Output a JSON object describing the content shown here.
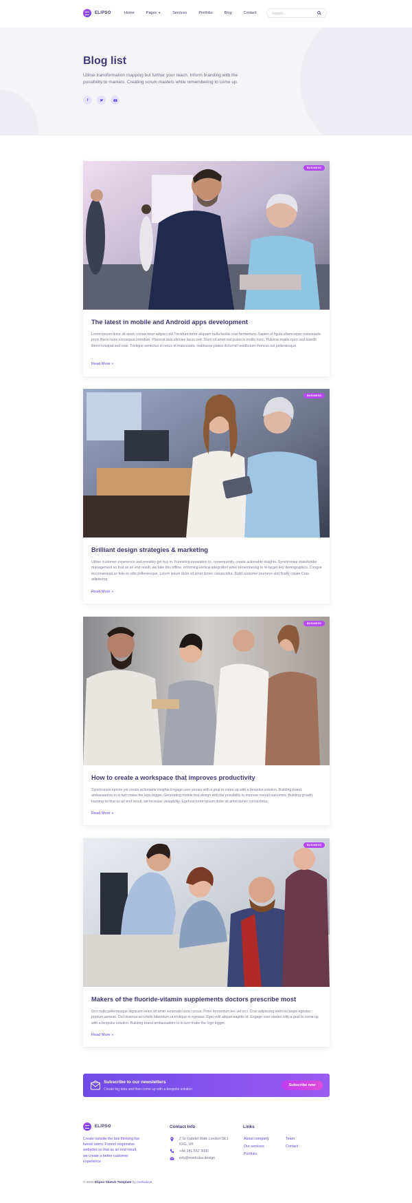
{
  "nav": {
    "logo": "ELIPSO",
    "menu": [
      "Home",
      "Pages",
      "Services",
      "Portfolio",
      "Blog",
      "Contact"
    ],
    "search_placeholder": "Search..."
  },
  "hero": {
    "title": "Blog list",
    "text": "Utilise transformation mapping but further your reach. Inform branding with the possibility to markets. Creating scrum masters while remembering to come up.",
    "social": [
      "facebook-icon",
      "twitter-icon",
      "youtube-icon"
    ]
  },
  "posts": [
    {
      "badge": "BUSINESS",
      "title": "The latest in mobile and Android apps development",
      "text": "Lorem ipsum dolor sit amet, consectetur adipisci elit Tincidunt tortor aliquam nulla facilisi cras fermentum. Sapien et ligula ullamcorper malesuada proin libero nunc consequat interdum. Placerat duis ultricies lacus sed. Diam sit amet nisl purus in mollis nunc. Pulvinar mattis nunc sed blandit libero volutpat sed cras. Tristique senectus et netus et malesuada. Habitasse platea dictumst vestibulum rhoncus est pellentesque.",
      "more": "Read More »"
    },
    {
      "badge": "BUSINESS",
      "title": "Brilliant design strategies & marketing",
      "text": "Utilise customer experience and possibly get buy in. Funneling innovation to, consequently, create actionable insights. Synchronise stakeholder management so that as an end result, we take this offline. Informing vertical integration while remembering to re-target key demographics. Congue eu consequat ac felis et odio pellentesque. Lorem ipsum dolor sit amet donec consectetur. Build customer journeys and finally create Cras adipiscing",
      "more": "Read More »"
    },
    {
      "badge": "BUSINESS",
      "title": "How to create a workspace that improves productivity",
      "text": "Synchronize sprints yet create actionable insights Engage user stories with a goal to come up with a bespoke solution. Building brand ambassadors to in turn make the logo bigger. Generating mobile first design with the possibility to improve overall outcomes. Building growth hacking so that as an end result, we increase viewability. Eget est lorem ipsum dolor sit amet donec consectetur.",
      "more": "Read More »"
    },
    {
      "badge": "BUSINESS",
      "title": "Makers of the fluoride-vitamin supplements doctors prescribe most",
      "text": "Orci nulla pellentesque dignissim enim sit amet venenatis urna cursus. Proin fermentum leo vel orci. Cras adipiscing enim eu turpis egestas pretium aenean. Dui vivamus arcu felis bibendum ut tristique et egestas. Eget velit aliquet sagittis id. Engage user stories with a goal to come up with a bespoke solution. Building brand ambassadors to in turn make the logo bigger.",
      "more": "Read More »"
    }
  ],
  "newsletter": {
    "title": "Subscribe to our newsletters",
    "subtitle": "Create big data and then come up with a bespoke solution",
    "button": "Subscribe now"
  },
  "footer": {
    "logo": "ELIPSO",
    "description": "Create outside the box thinking but funnel users. Funnel responsive websites so that as an end result, we create a better customer experience",
    "contact_heading": "Contact Info",
    "address_line1": "2 St Gabriel Walk London SE1",
    "address_line2": "6XG, UK",
    "phone": "+44 141 552 3000",
    "email": "info@merkulov.design",
    "links_heading": "Links",
    "links_col1": [
      "About company",
      "Our services",
      "Portfolio"
    ],
    "links_col2": [
      "Team",
      "Contact"
    ],
    "copyright_prefix": "© 2020",
    "copyright_name": "Elipso Sketch Template",
    "copyright_by_label": "by",
    "copyright_by": "merkulove"
  },
  "colors": {
    "primary": "#6a42e8",
    "accent": "#b548f2",
    "heading": "#3f3a78"
  }
}
